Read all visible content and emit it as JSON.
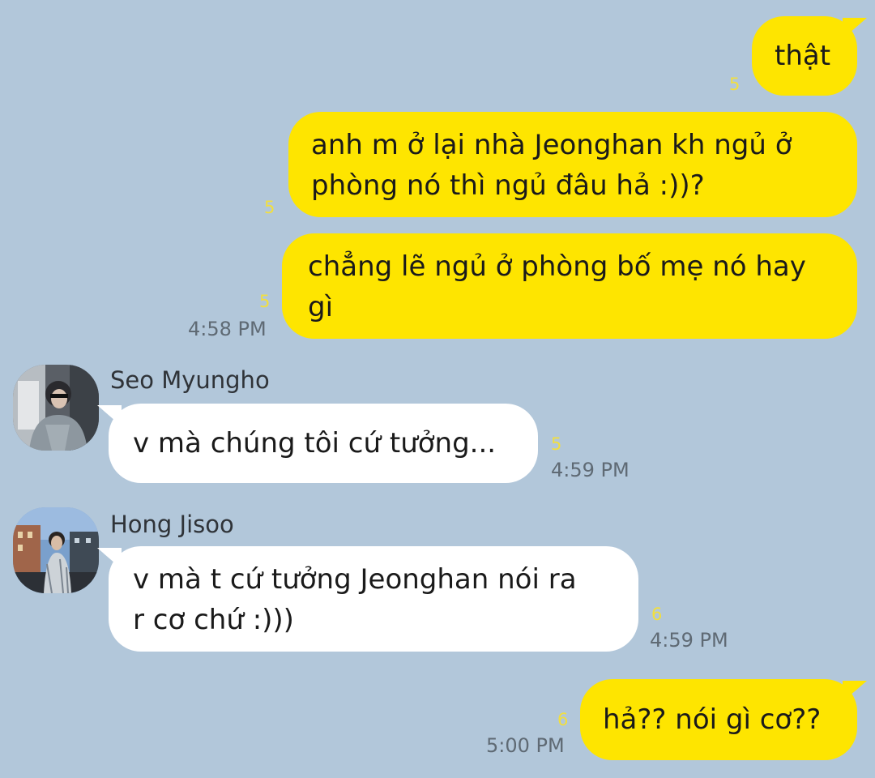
{
  "colors": {
    "background": "#b2c7da",
    "my_bubble": "#fee500",
    "their_bubble": "#ffffff",
    "unread_count": "#f2df3e",
    "timestamp": "#5f6a74"
  },
  "messages": [
    {
      "from": "me",
      "lines": [
        "thật"
      ],
      "unread": "5",
      "time": ""
    },
    {
      "from": "me",
      "lines": [
        "anh m ở lại nhà Jeonghan kh ngủ ở",
        "phòng nó thì ngủ đâu hả :))?"
      ],
      "unread": "5",
      "time": ""
    },
    {
      "from": "me",
      "lines": [
        "chẳng lẽ ngủ ở phòng bố mẹ nó hay",
        "gì"
      ],
      "unread": "5",
      "time": "4:58 PM"
    },
    {
      "from": "other",
      "sender": "Seo Myungho",
      "avatar_icon": "person-photo-avatar",
      "lines": [
        "v mà chúng tôi cứ tưởng..."
      ],
      "unread": "5",
      "time": "4:59 PM"
    },
    {
      "from": "other",
      "sender": "Hong Jisoo",
      "avatar_icon": "city-person-photo-avatar",
      "lines": [
        "v mà t cứ tưởng Jeonghan nói ra",
        "r cơ chứ :)))"
      ],
      "unread": "6",
      "time": "4:59 PM"
    },
    {
      "from": "me",
      "lines": [
        "hả?? nói gì cơ??"
      ],
      "unread": "6",
      "time": "5:00 PM"
    }
  ]
}
